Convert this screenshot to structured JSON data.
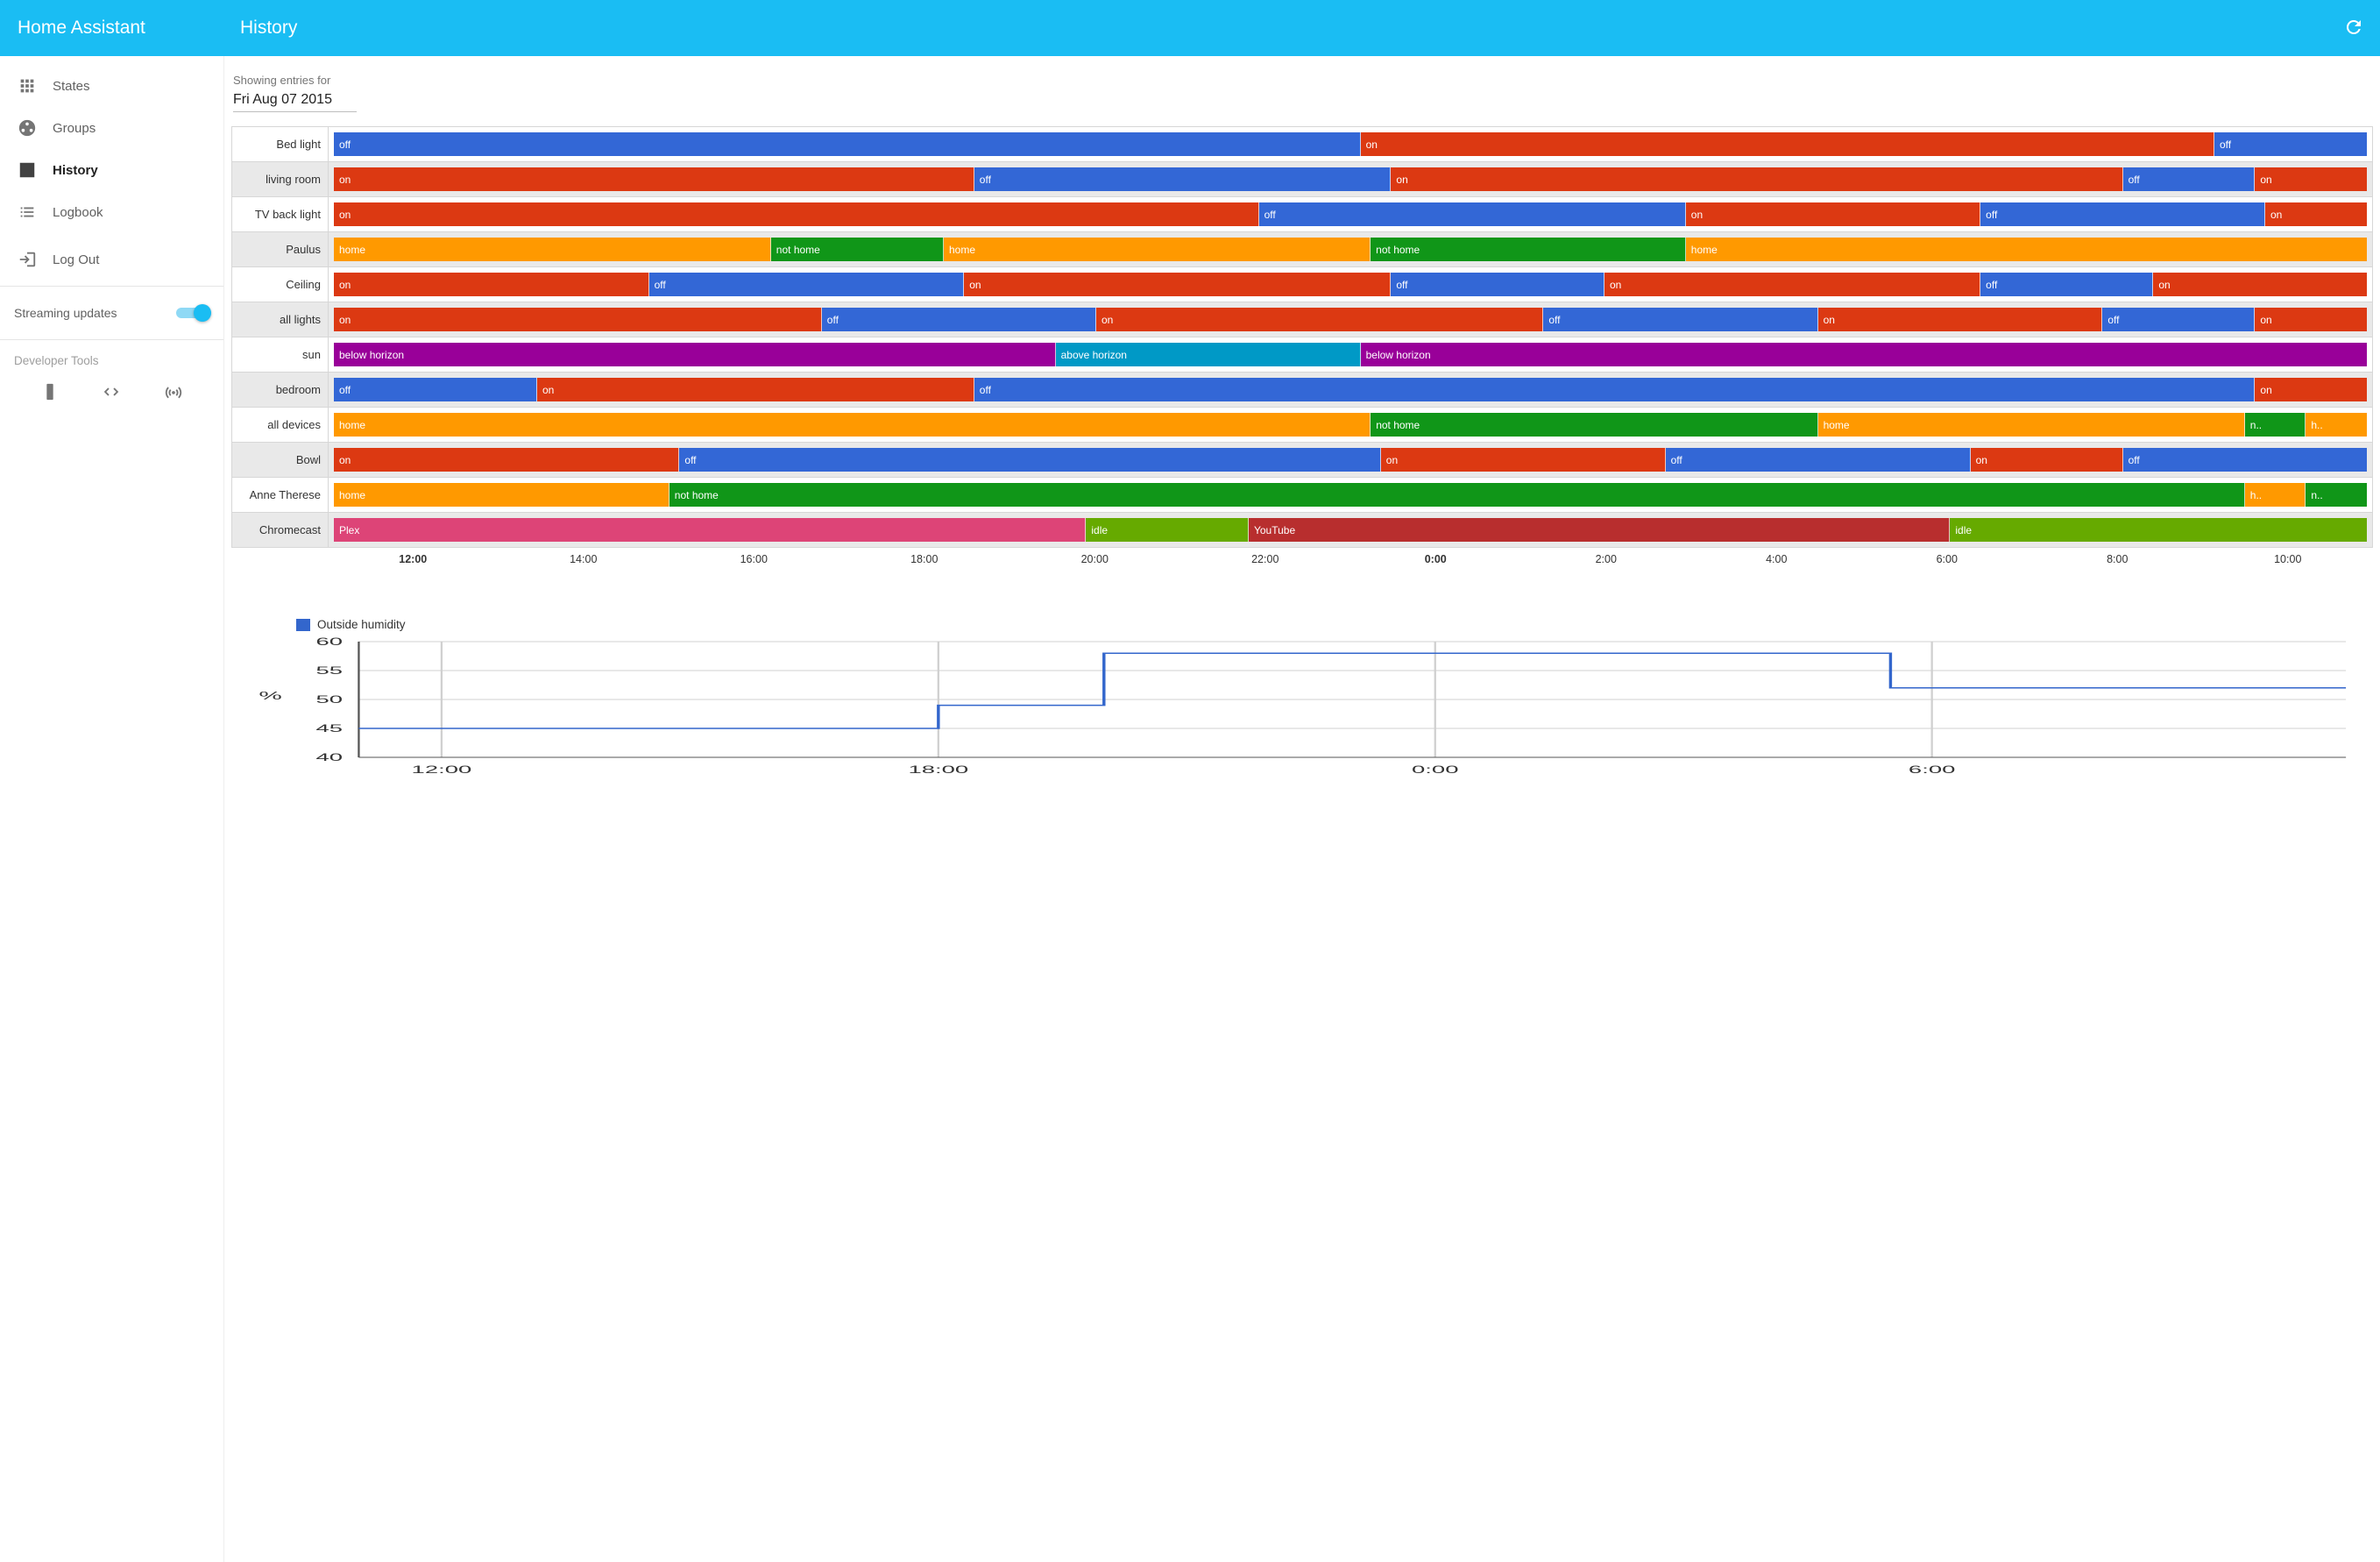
{
  "colors": {
    "blue": "#3367d6",
    "red": "#dc3912",
    "orange": "#ff9900",
    "green": "#109618",
    "purple": "#990099",
    "cyan": "#0099c6",
    "pink": "#dd4477",
    "olive": "#66aa00",
    "darkred": "#b82e2e"
  },
  "header": {
    "app_title": "Home Assistant",
    "page_title": "History"
  },
  "sidebar": {
    "nav": [
      {
        "id": "states",
        "label": "States",
        "icon": "apps-icon",
        "active": false
      },
      {
        "id": "groups",
        "label": "Groups",
        "icon": "group-icon",
        "active": false
      },
      {
        "id": "history",
        "label": "History",
        "icon": "chart-icon",
        "active": true
      },
      {
        "id": "logbook",
        "label": "Logbook",
        "icon": "list-icon",
        "active": false
      }
    ],
    "logout_label": "Log Out",
    "streaming_label": "Streaming updates",
    "streaming_on": true,
    "dev_header": "Developer Tools"
  },
  "date_picker": {
    "label": "Showing entries for",
    "value": "Fri Aug 07 2015"
  },
  "color_map": {
    "on": "red",
    "off": "blue",
    "home": "orange",
    "not home": "green",
    "h..": "orange",
    "n..": "green",
    "below horizon": "purple",
    "above horizon": "cyan",
    "Plex": "pink",
    "idle": "olive",
    "YouTube": "darkred"
  },
  "timeline": {
    "rows": [
      {
        "label": "Bed light",
        "segs": [
          {
            "t": "off",
            "w": 50.5
          },
          {
            "t": "on",
            "w": 42
          },
          {
            "t": "off",
            "w": 7.5
          }
        ]
      },
      {
        "label": "living room",
        "segs": [
          {
            "t": "on",
            "w": 31.5
          },
          {
            "t": "off",
            "w": 20.5
          },
          {
            "t": "on",
            "w": 36
          },
          {
            "t": "off",
            "w": 6.5
          },
          {
            "t": "on",
            "w": 5.5
          }
        ]
      },
      {
        "label": "TV back light",
        "segs": [
          {
            "t": "on",
            "w": 45.5
          },
          {
            "t": "off",
            "w": 21
          },
          {
            "t": "on",
            "w": 14.5
          },
          {
            "t": "off",
            "w": 14
          },
          {
            "t": "on",
            "w": 5
          }
        ]
      },
      {
        "label": "Paulus",
        "segs": [
          {
            "t": "home",
            "w": 21.5
          },
          {
            "t": "not home",
            "w": 8.5
          },
          {
            "t": "home",
            "w": 21
          },
          {
            "t": "not home",
            "w": 15.5
          },
          {
            "t": "home",
            "w": 33.5
          }
        ]
      },
      {
        "label": "Ceiling",
        "segs": [
          {
            "t": "on",
            "w": 15.5
          },
          {
            "t": "off",
            "w": 15.5
          },
          {
            "t": "on",
            "w": 21
          },
          {
            "t": "off",
            "w": 10.5
          },
          {
            "t": "on",
            "w": 18.5
          },
          {
            "t": "off",
            "w": 8.5
          },
          {
            "t": "on",
            "w": 10.5
          }
        ]
      },
      {
        "label": "all lights",
        "segs": [
          {
            "t": "on",
            "w": 24
          },
          {
            "t": "off",
            "w": 13.5
          },
          {
            "t": "on",
            "w": 22
          },
          {
            "t": "off",
            "w": 13.5
          },
          {
            "t": "on",
            "w": 14
          },
          {
            "t": "off",
            "w": 7.5
          },
          {
            "t": "on",
            "w": 5.5
          }
        ]
      },
      {
        "label": "sun",
        "segs": [
          {
            "t": "below horizon",
            "w": 35.5
          },
          {
            "t": "above horizon",
            "w": 15
          },
          {
            "t": "below horizon",
            "w": 49.5
          }
        ]
      },
      {
        "label": "bedroom",
        "segs": [
          {
            "t": "off",
            "w": 10
          },
          {
            "t": "on",
            "w": 21.5
          },
          {
            "t": "off",
            "w": 63
          },
          {
            "t": "on",
            "w": 5.5
          }
        ]
      },
      {
        "label": "all devices",
        "segs": [
          {
            "t": "home",
            "w": 51
          },
          {
            "t": "not home",
            "w": 22
          },
          {
            "t": "home",
            "w": 21
          },
          {
            "t": "n..",
            "w": 3
          },
          {
            "t": "h..",
            "w": 3
          }
        ]
      },
      {
        "label": "Bowl",
        "segs": [
          {
            "t": "on",
            "w": 17
          },
          {
            "t": "off",
            "w": 34.5
          },
          {
            "t": "on",
            "w": 14
          },
          {
            "t": "off",
            "w": 15
          },
          {
            "t": "on",
            "w": 7.5
          },
          {
            "t": "off",
            "w": 12
          }
        ]
      },
      {
        "label": "Anne Therese",
        "segs": [
          {
            "t": "home",
            "w": 16.5
          },
          {
            "t": "not home",
            "w": 77.5
          },
          {
            "t": "h..",
            "w": 3
          },
          {
            "t": "n..",
            "w": 3
          }
        ]
      },
      {
        "label": "Chromecast",
        "segs": [
          {
            "t": "Plex",
            "w": 37
          },
          {
            "t": "idle",
            "w": 8
          },
          {
            "t": "YouTube",
            "w": 34.5
          },
          {
            "t": "idle",
            "w": 20.5
          }
        ]
      }
    ],
    "ticks": [
      {
        "t": "12:00",
        "bold": true
      },
      {
        "t": "14:00"
      },
      {
        "t": "16:00"
      },
      {
        "t": "18:00"
      },
      {
        "t": "20:00"
      },
      {
        "t": "22:00"
      },
      {
        "t": "0:00",
        "bold": true
      },
      {
        "t": "2:00"
      },
      {
        "t": "4:00"
      },
      {
        "t": "6:00"
      },
      {
        "t": "8:00"
      },
      {
        "t": "10:00"
      }
    ]
  },
  "chart_data": {
    "type": "line",
    "title": "Outside humidity",
    "legend": "Outside humidity",
    "ylabel": "%",
    "ylim": [
      40,
      60
    ],
    "yticks": [
      40,
      45,
      50,
      55,
      60
    ],
    "xticks": [
      "12:00",
      "18:00",
      "0:00",
      "6:00"
    ],
    "x": [
      11,
      17,
      18,
      20,
      5.5,
      11
    ],
    "y": [
      45,
      45,
      49,
      58,
      58,
      52
    ],
    "points_desc": "step line: 45 from ~11:00 to ~17:00, step to 49 until ~18:00, step to 58 held until ~05:30, step down to 52 held to end"
  }
}
